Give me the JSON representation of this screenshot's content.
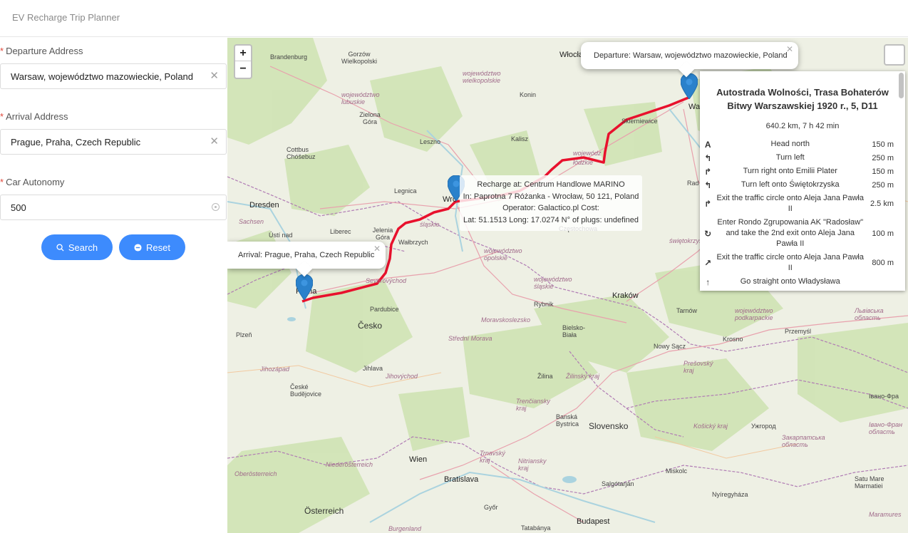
{
  "app": {
    "title": "EV Recharge Trip Planner"
  },
  "form": {
    "departure": {
      "label": "Departure Address",
      "value": "Warsaw, województwo mazowieckie, Poland"
    },
    "arrival": {
      "label": "Arrival Address",
      "value": "Prague, Praha, Czech Republic"
    },
    "autonomy": {
      "label": "Car Autonomy",
      "value": "500"
    },
    "search_label": "Search",
    "reset_label": "Reset"
  },
  "map": {
    "zoom_in": "+",
    "zoom_out": "−",
    "departure_popup": "Departure: Warsaw, województwo mazowieckie, Poland",
    "arrival_popup": "Arrival: Prague, Praha, Czech Republic",
    "recharge": {
      "line1": "Recharge at: Centrum Handlowe MARINO",
      "line2": "In: Paprotna 7 Różanka - Wrocław, 50 121, Poland",
      "line3": "Operator: Galactico.pl Cost:",
      "line4": "Lat: 51.1513 Long: 17.0274 N° of plugs: undefined"
    },
    "route_color": "#e8112d",
    "labels": {
      "wloclawek": "Włocław",
      "wielkopolska": "Gorzów Wielkopolski",
      "brandenburg": "Brandenburg",
      "lubuskie": "województwo lubuskie",
      "wielkopolskie": "województwo wielkopolskie",
      "zielona": "Zielona Góra",
      "konin": "Konin",
      "kalisz": "Kalisz",
      "leszno": "Leszno",
      "cottbus": "Cottbus Chóšebuz",
      "legnica": "Legnica",
      "dresden": "Dresden",
      "sachsen": "Sachsen",
      "usti": "Ústí nad",
      "liberec": "Liberec",
      "jelenia": "Jelenia Góra",
      "walbrzych": "Wałbrzych",
      "slaskie": "śląskie",
      "wroclaw": "Wro",
      "warszawa": "Warszaw",
      "skierniewice": "Skierniewice",
      "opolskie": "województwo opolskie",
      "slaskie2": "województwo śląskie",
      "praha": "Praha",
      "pardubice": "Pardubice",
      "severovychod": "Severovýchod",
      "cesko": "Česko",
      "plzen": "Plzeň",
      "jihozapad": "Jihozápad",
      "jihlava": "Jihlava",
      "jihovychod": "Jihovýchod",
      "ceske": "České Budějovice",
      "moravskoslezsko": "Moravskoslezsko",
      "stredni": "Střední Morava",
      "rybnik": "Rybnik",
      "krakow": "Kraków",
      "bielsko": "Bielsko-Biała",
      "tarnow": "Tarnów",
      "podkarpackie": "województwo podkarpackie",
      "przemysl": "Przemyśl",
      "nowy": "Nowy Sącz",
      "krosno": "Krosno",
      "lviv": "Львівська область",
      "zilina": "Žilina",
      "zilinsky": "Žilinský kraj",
      "trenciansky": "Trenčiansky kraj",
      "presovsky": "Prešovský kraj",
      "kosice": "Košický kraj",
      "banska": "Banská Bystrica",
      "slovensko": "Slovensko",
      "uzhhorod": "Ужгород",
      "zakarpattia": "Закарпатська область",
      "ivano": "Івано-Фра",
      "ivano2": "Івано-Фран область",
      "wien": "Wien",
      "bratislava": "Bratislava",
      "niederosterreich": "Niederösterreich",
      "oberosterreich": "Oberösterreich",
      "osterreich": "Österreich",
      "trnavsky": "Trnavský kraj",
      "nitriansky": "Nitriansky kraj",
      "miskolc": "Miskolc",
      "salgotarjan": "Salgótarján",
      "nyiregyhaza": "Nyíregyháza",
      "satu": "Satu Mare Marmatiei",
      "maramures": "Maramures",
      "gyor": "Győr",
      "budapest": "Budapest",
      "tatabanya": "Tatabánya",
      "burgenland": "Burgenland",
      "swietokrzyskie": "świętokrzyskie",
      "radom": "Rad",
      "czestochowa": "Częstochowa",
      "wojewodztwo": "wojewódz",
      "lodzkie": "łódzkie"
    }
  },
  "routing": {
    "title": "Autostrada Wolności, Trasa Bohaterów Bitwy Warszawskiej 1920 r., 5, D11",
    "summary": "640.2 km, 7 h 42 min",
    "steps": [
      {
        "icon": "head-north-icon",
        "glyph": "A",
        "text": "Head north",
        "dist": "150 m"
      },
      {
        "icon": "turn-left-icon",
        "glyph": "↰",
        "text": "Turn left",
        "dist": "250 m"
      },
      {
        "icon": "turn-right-icon",
        "glyph": "↱",
        "text": "Turn right onto Emilii Plater",
        "dist": "150 m"
      },
      {
        "icon": "turn-left-icon",
        "glyph": "↰",
        "text": "Turn left onto Świętokrzyska",
        "dist": "250 m"
      },
      {
        "icon": "roundabout-exit-icon",
        "glyph": "↱",
        "text": "Exit the traffic circle onto Aleja Jana Pawła II",
        "dist": "2.5 km"
      },
      {
        "icon": "roundabout-icon",
        "glyph": "↻",
        "text": "Enter Rondo Zgrupowania AK \"Radosław\" and take the 2nd exit onto Aleja Jana Pawła II",
        "dist": "100 m"
      },
      {
        "icon": "roundabout-exit-icon",
        "glyph": "↗",
        "text": "Exit the traffic circle onto Aleja Jana Pawła II",
        "dist": "800 m"
      },
      {
        "icon": "straight-icon",
        "glyph": "↑",
        "text": "Go straight onto Władysława",
        "dist": ""
      }
    ]
  }
}
